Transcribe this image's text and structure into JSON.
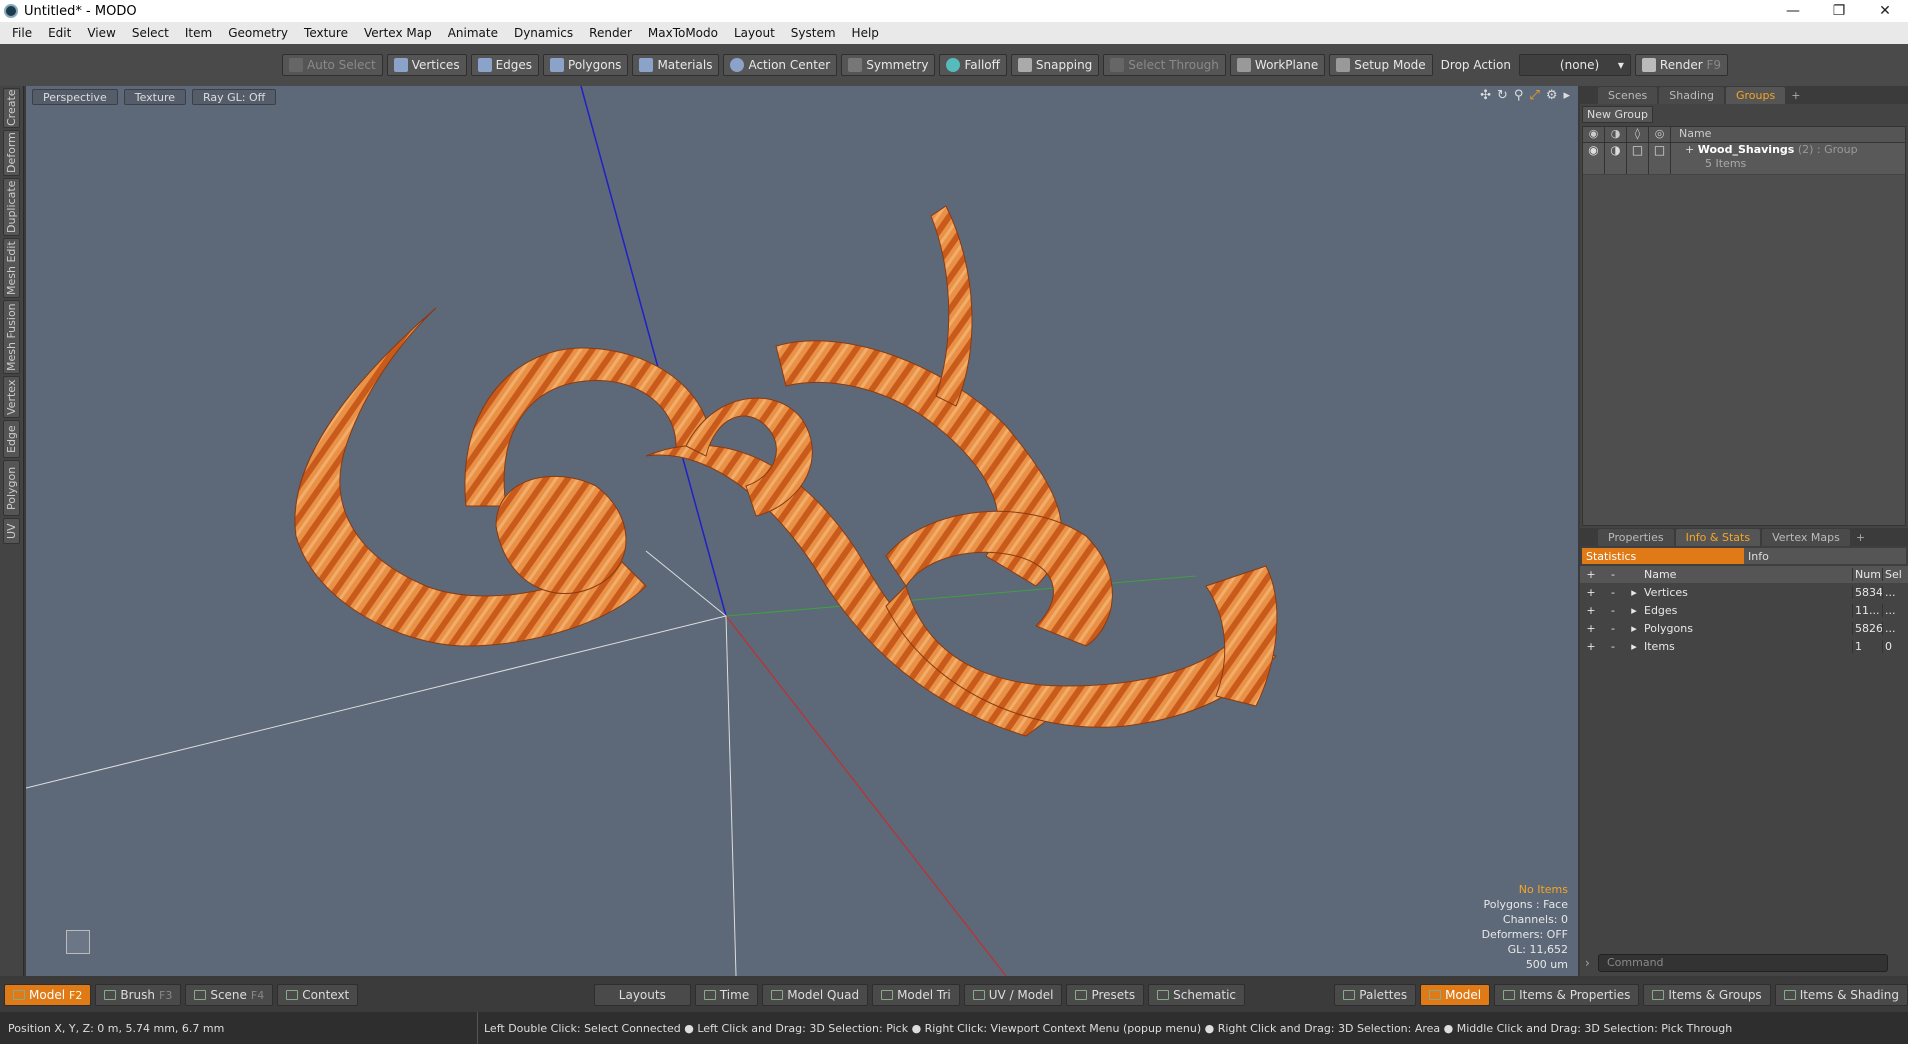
{
  "window": {
    "title": "Untitled* - MODO"
  },
  "menu": [
    "File",
    "Edit",
    "View",
    "Select",
    "Item",
    "Geometry",
    "Texture",
    "Vertex Map",
    "Animate",
    "Dynamics",
    "Render",
    "MaxToModo",
    "Layout",
    "System",
    "Help"
  ],
  "toolbar": {
    "auto_select": "Auto Select",
    "vertices": "Vertices",
    "edges": "Edges",
    "polygons": "Polygons",
    "materials": "Materials",
    "action_center": "Action Center",
    "symmetry": "Symmetry",
    "falloff": "Falloff",
    "snapping": "Snapping",
    "select_through": "Select Through",
    "workplane": "WorkPlane",
    "setup_mode": "Setup Mode",
    "drop_action_label": "Drop Action",
    "drop_action_value": "(none)",
    "render": "Render",
    "render_key": "F9"
  },
  "left_tabs": [
    "Create",
    "Deform",
    "Duplicate",
    "Mesh Edit",
    "Mesh Fusion",
    "Vertex",
    "Edge",
    "Polygon",
    "UV"
  ],
  "viewport": {
    "view": "Perspective",
    "shading": "Texture",
    "raygl": "Ray GL: Off",
    "info": {
      "items": "No Items",
      "polygons": "Polygons : Face",
      "channels": "Channels: 0",
      "deformers": "Deformers: OFF",
      "gl": "GL: 11,652",
      "scale": "500 um"
    }
  },
  "groups_panel": {
    "tabs": [
      "Scenes",
      "Shading",
      "Groups"
    ],
    "active_tab": "Groups",
    "new_group": "New Group",
    "col_name": "Name",
    "group": {
      "name": "Wood_Shavings",
      "count": "(2)",
      "type": ": Group",
      "items": "5 Items"
    }
  },
  "stats_panel": {
    "tabs": [
      "Properties",
      "Info & Stats",
      "Vertex Maps"
    ],
    "active_tab": "Info & Stats",
    "sub_tabs": [
      "Statistics",
      "Info"
    ],
    "columns": {
      "name": "Name",
      "num": "Num",
      "sel": "Sel"
    },
    "rows": [
      {
        "name": "Vertices",
        "num": "5834",
        "sel": "..."
      },
      {
        "name": "Edges",
        "num": "11...",
        "sel": "..."
      },
      {
        "name": "Polygons",
        "num": "5826",
        "sel": "..."
      },
      {
        "name": "Items",
        "num": "1",
        "sel": "0"
      }
    ],
    "command_placeholder": "Command"
  },
  "bottom": {
    "model": "Model",
    "model_key": "F2",
    "brush": "Brush",
    "brush_key": "F3",
    "scene": "Scene",
    "scene_key": "F4",
    "context": "Context",
    "layouts": "Layouts",
    "time": "Time",
    "model_quad": "Model Quad",
    "model_tri": "Model Tri",
    "uv_model": "UV / Model",
    "presets": "Presets",
    "schematic": "Schematic",
    "palettes": "Palettes",
    "model2": "Model",
    "items_props": "Items & Properties",
    "items_groups": "Items & Groups",
    "items_shading": "Items & Shading"
  },
  "status": {
    "position": "Position X, Y, Z:   0 m, 5.74 mm, 6.7 mm",
    "hint": "Left Double Click: Select Connected ● Left Click and Drag: 3D Selection: Pick ● Right Click: Viewport Context Menu (popup menu) ● Right Click and Drag: 3D Selection: Area ● Middle Click and Drag: 3D Selection: Pick Through"
  },
  "colors": {
    "accent": "#e07a16",
    "viewport_bg": "#5d6878",
    "wood": "#e8832a"
  }
}
